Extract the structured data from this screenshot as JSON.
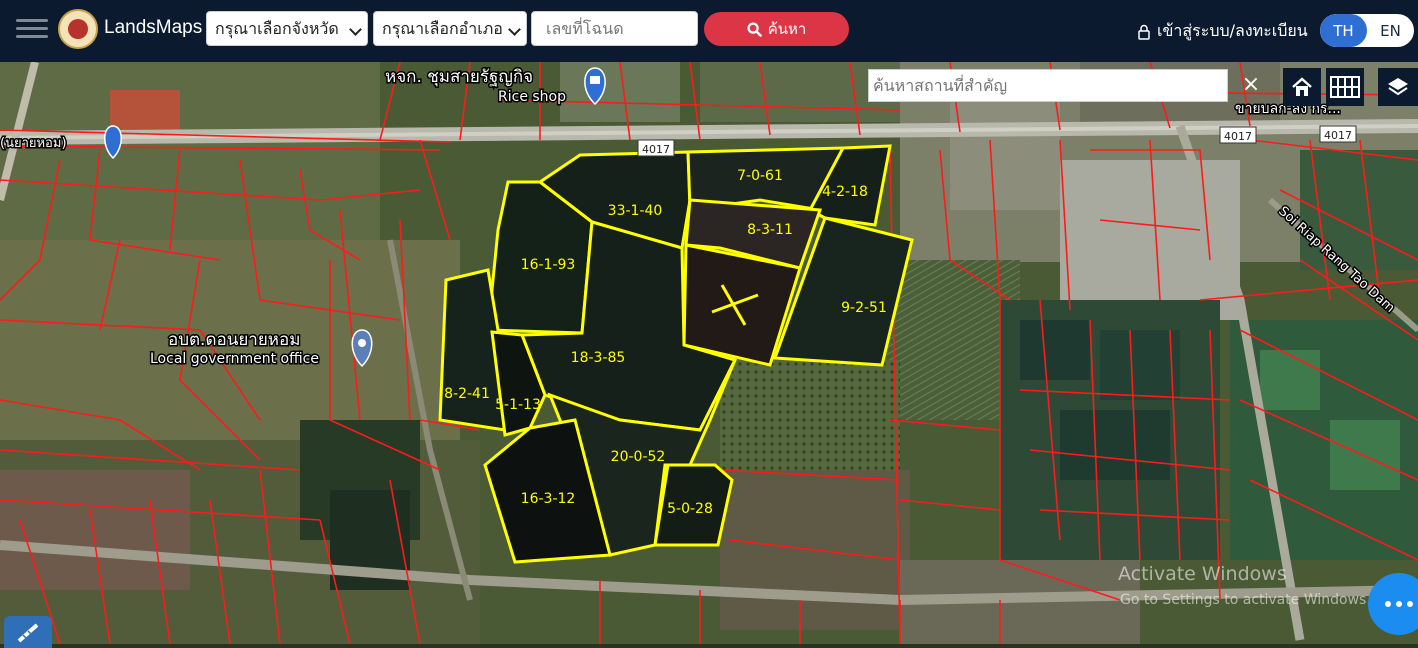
{
  "header": {
    "brand": "LandsMaps",
    "province_select": "กรุณาเลือกจังหวัด",
    "district_select": "กรุณาเลือกอำเภอ",
    "deed_placeholder": "เลขที่โฉนด",
    "search_button": "ค้นหา",
    "login_label": "เข้าสู่ระบบ/ลงทะเบียน",
    "lang_th": "TH",
    "lang_en": "EN"
  },
  "map": {
    "place_search_placeholder": "ค้นหาสถานที่สำคัญ",
    "clear_symbol": "×",
    "labels": {
      "rice_shop_thai": "หจก. ชุมสายรัฐญกิจ",
      "rice_shop": "Rice shop",
      "office_thai": "อบต.ดอนยายหอม",
      "office": "Local government office",
      "left_road": "(นยายหอม)",
      "road_4017_a": "4017",
      "road_4017_b": "4017",
      "road_4017_c": "4017",
      "soi": "Soi Riap Rang Tao Dam",
      "top_right": "ขายบลก-ลง กร..."
    },
    "parcels": [
      {
        "label": "33-1-40"
      },
      {
        "label": "7-0-61"
      },
      {
        "label": "4-2-18"
      },
      {
        "label": "8-3-11"
      },
      {
        "label": "16-1-93"
      },
      {
        "label": "9-2-51"
      },
      {
        "label": "18-3-85"
      },
      {
        "label": "8-2-41"
      },
      {
        "label": "5-1-13"
      },
      {
        "label": "20-0-52"
      },
      {
        "label": "16-3-12"
      },
      {
        "label": "5-0-28"
      }
    ],
    "watermark_line1": "Activate Windows",
    "watermark_line2": "Go to Settings to activate Windows."
  },
  "colors": {
    "header_bg": "#0b1a2e",
    "search_button": "#dc3545",
    "lang_active": "#2f6fd3",
    "parcel_outline": "#ffff00",
    "cadastral_lines": "#ff1a1a",
    "fab": "#1b8cf0"
  },
  "icons": {
    "menu": "hamburger-icon",
    "search": "magnifier-icon",
    "lock": "lock-icon",
    "home": "home-icon",
    "grid": "grid-icon",
    "layers": "layers-icon",
    "more": "dots-icon",
    "measure": "ruler-icon"
  }
}
